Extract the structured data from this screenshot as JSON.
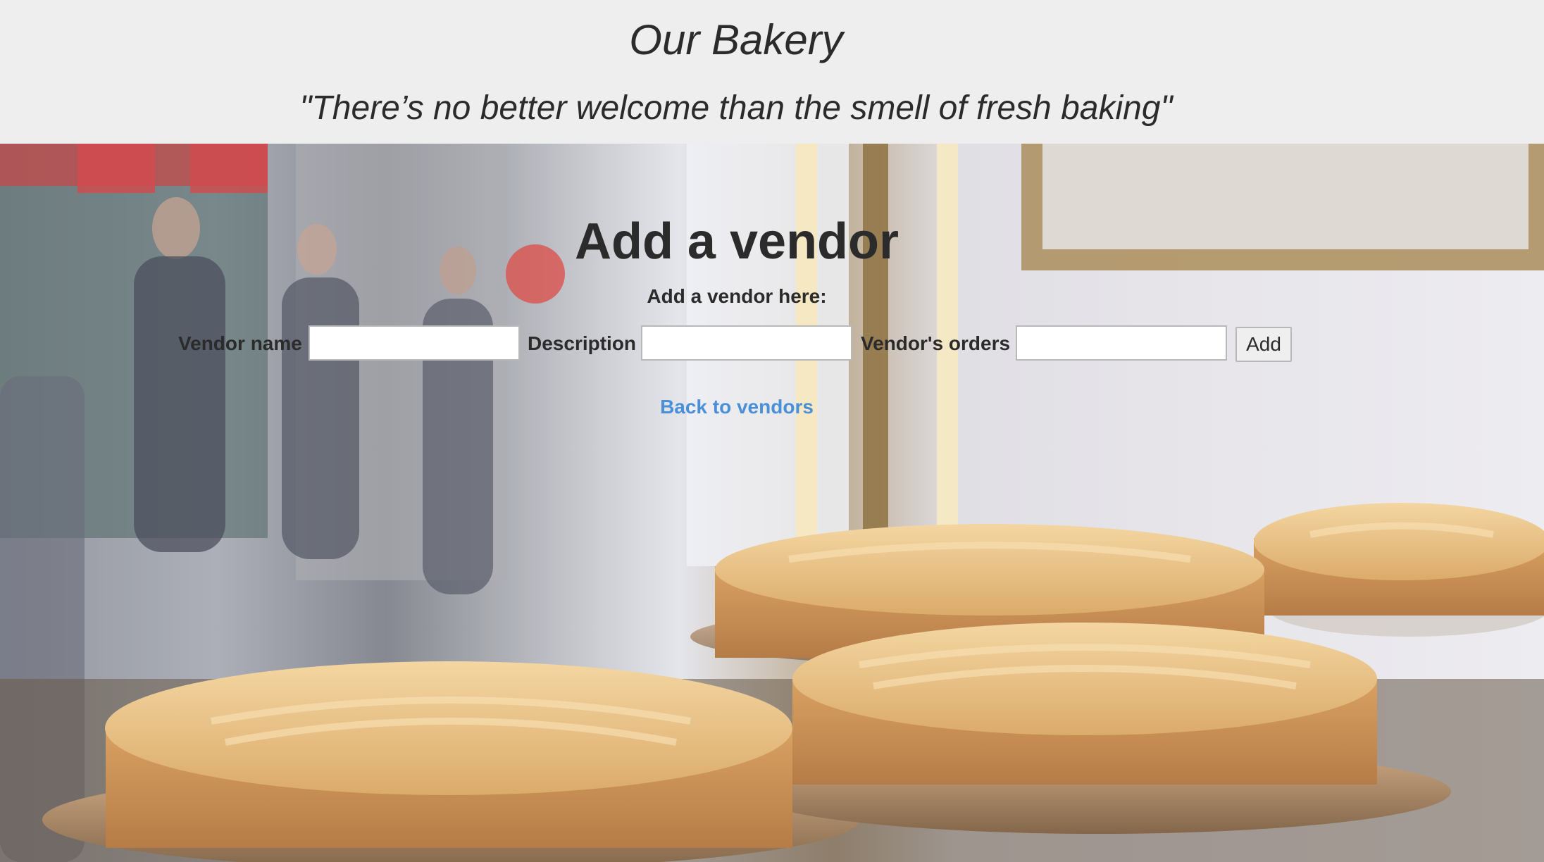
{
  "header": {
    "title": "Our Bakery",
    "quote": "\"There’s no better welcome than the smell of fresh baking\""
  },
  "hero": {
    "image_description_icon": "bakery-pies-photo"
  },
  "form": {
    "title": "Add a vendor",
    "subtitle": "Add a vendor here:",
    "fields": [
      {
        "label": "Vendor name",
        "value": "",
        "placeholder": ""
      },
      {
        "label": "Description",
        "value": "",
        "placeholder": ""
      },
      {
        "label": "Vendor's orders",
        "value": "",
        "placeholder": ""
      }
    ],
    "submit_label": "Add"
  },
  "nav": {
    "back_link": "Back to vendors"
  },
  "colors": {
    "header_bg": "#eeeeee",
    "text": "#2b2b2b",
    "link": "#4a90d9"
  }
}
